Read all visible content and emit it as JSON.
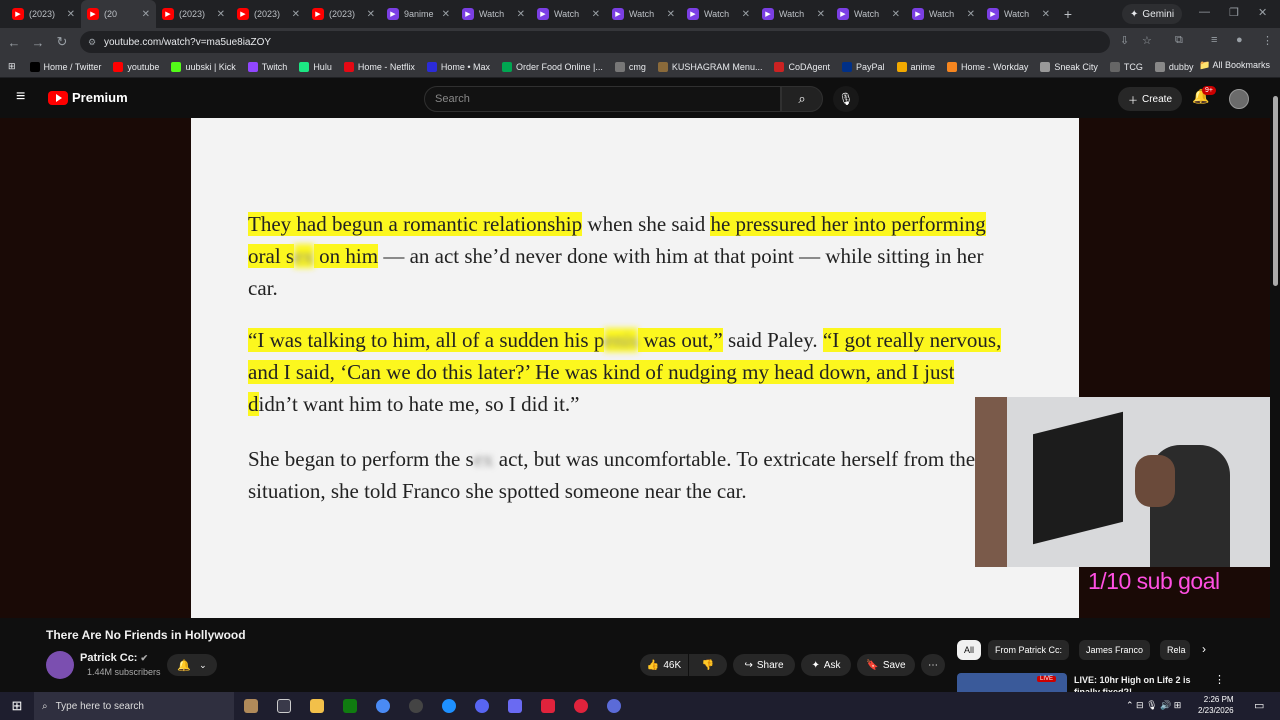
{
  "browser": {
    "tabs": [
      {
        "label": "(2023)",
        "icon": "youtube-icon"
      },
      {
        "label": "(20",
        "icon": "youtube-icon",
        "active": true
      },
      {
        "label": "(2023)",
        "icon": "youtube-icon"
      },
      {
        "label": "(2023)",
        "icon": "youtube-icon"
      },
      {
        "label": "(2023)",
        "icon": "youtube-icon"
      },
      {
        "label": "9anime",
        "icon": "purple-play-icon"
      },
      {
        "label": "Watch",
        "icon": "purple-play-icon"
      },
      {
        "label": "Watch",
        "icon": "purple-play-icon"
      },
      {
        "label": "Watch",
        "icon": "purple-play-icon"
      },
      {
        "label": "Watch",
        "icon": "purple-play-icon"
      },
      {
        "label": "Watch",
        "icon": "purple-play-icon"
      },
      {
        "label": "Watch",
        "icon": "purple-play-icon"
      },
      {
        "label": "Watch",
        "icon": "purple-play-icon"
      },
      {
        "label": "Watch",
        "icon": "purple-play-icon"
      }
    ],
    "gemini_label": "Gemini",
    "url": "youtube.com/watch?v=ma5ue8iaZOY",
    "bookmarks": [
      {
        "label": "Home / Twitter",
        "color": "#000000"
      },
      {
        "label": "youtube",
        "color": "#ff0000"
      },
      {
        "label": "uubski | Kick",
        "color": "#53fc18"
      },
      {
        "label": "Twitch",
        "color": "#9146ff"
      },
      {
        "label": "Hulu",
        "color": "#1ce783"
      },
      {
        "label": "Home - Netflix",
        "color": "#e50914"
      },
      {
        "label": "Home • Max",
        "color": "#2b2bd8"
      },
      {
        "label": "Order Food Online |...",
        "color": "#00a651"
      },
      {
        "label": "cmg",
        "color": "#777777"
      },
      {
        "label": "KUSHAGRAM Menu...",
        "color": "#8a6a3a"
      },
      {
        "label": "CoDAgent",
        "color": "#cc2222"
      },
      {
        "label": "PayPal",
        "color": "#003087"
      },
      {
        "label": "anime",
        "color": "#f2a900"
      },
      {
        "label": "Home - Workday",
        "color": "#f6861f"
      },
      {
        "label": "Sneak City",
        "color": "#999999"
      },
      {
        "label": "TCG",
        "color": "#666666"
      },
      {
        "label": "dubby",
        "color": "#888888"
      }
    ],
    "all_bookmarks": "All Bookmarks"
  },
  "youtube": {
    "logo_text": "Premium",
    "search_placeholder": "Search",
    "create_label": "Create",
    "notif_badge": "9+"
  },
  "video": {
    "paragraphs": [
      {
        "segments": [
          {
            "text": "They had begun a romantic relationship",
            "hl": true
          },
          {
            "text": " when she said ",
            "hl": false
          },
          {
            "text": "he pressured her into performing oral s",
            "hl": true
          },
          {
            "text": "ex",
            "hl": true,
            "blur": true
          },
          {
            "text": " on him",
            "hl": true
          },
          {
            "text": " — an act she’d never done with him at that point — while sitting in her car.",
            "hl": false
          }
        ]
      },
      {
        "segments": [
          {
            "text": "“I was talking to him, all of a sudden his p",
            "hl": true
          },
          {
            "text": "enis",
            "hl": true,
            "blur": true
          },
          {
            "text": " was out,”",
            "hl": true
          },
          {
            "text": " said Paley. ",
            "hl": false
          },
          {
            "text": "“I got really nervous, and I said, ‘Can we do this later?’ He was kind of nudging my head down, and I just d",
            "hl": true
          },
          {
            "text": "idn’t want him to hate me, so I did it.”",
            "hl": false
          }
        ]
      },
      {
        "segments": [
          {
            "text": "She began to perform the s",
            "hl": false
          },
          {
            "text": "ex",
            "hl": false,
            "blur": true
          },
          {
            "text": " act, but was uncomfortable. To extricate herself from the situation, she told Franco she spotted someone near the car.",
            "hl": false
          }
        ]
      }
    ],
    "overlay_text": "1/10 sub goal",
    "title": "There Are No Friends in Hollywood",
    "channel_name": "Patrick Cc:",
    "subscribers": "1.44M subscribers",
    "likes": "46K",
    "share_label": "Share",
    "ask_label": "Ask",
    "save_label": "Save"
  },
  "chips": [
    "All",
    "From Patrick Cc:",
    "James Franco",
    "Rela"
  ],
  "recommendation": {
    "live_badge": "LIVE",
    "title": "LIVE: 10hr High on Life 2 is finally fixed?!"
  },
  "taskbar": {
    "search_placeholder": "Type here to search",
    "time": "2:26 PM",
    "date": "2/23/2026"
  }
}
